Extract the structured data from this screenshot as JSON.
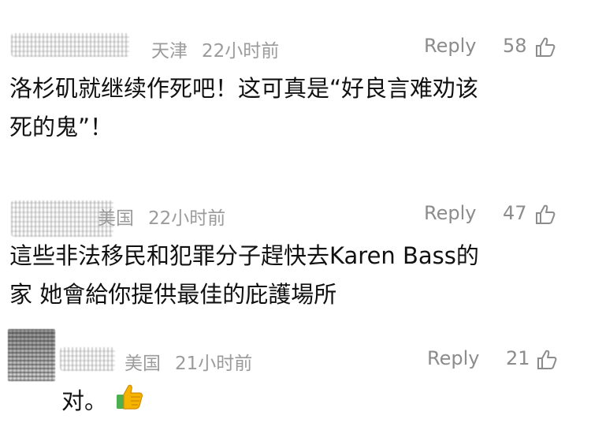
{
  "comments": [
    {
      "location": "天津",
      "time": "22小时前",
      "reply_label": "Reply",
      "likes": "58",
      "text_line1": "洛杉矶就继续作死吧！这可真是“好良言难劝该",
      "text_line2": "死的鬼”！"
    },
    {
      "location": "美国",
      "time": "22小时前",
      "reply_label": "Reply",
      "likes": "47",
      "text_line1": "這些非法移民和犯罪分子趕快去Karen Bass的",
      "text_line2": "家 她會給你提供最佳的庇護場所"
    },
    {
      "location": "美国",
      "time": "21小时前",
      "reply_label": "Reply",
      "likes": "21",
      "text_line1": "对。"
    }
  ],
  "icons": {
    "like": "thumbs-up-outline-icon",
    "emoji": "thumbs-up-emoji"
  },
  "colors": {
    "meta": "#9b9b9b",
    "text": "#111111",
    "emoji_yellow": "#f4b400",
    "emoji_green": "#4caf50"
  }
}
